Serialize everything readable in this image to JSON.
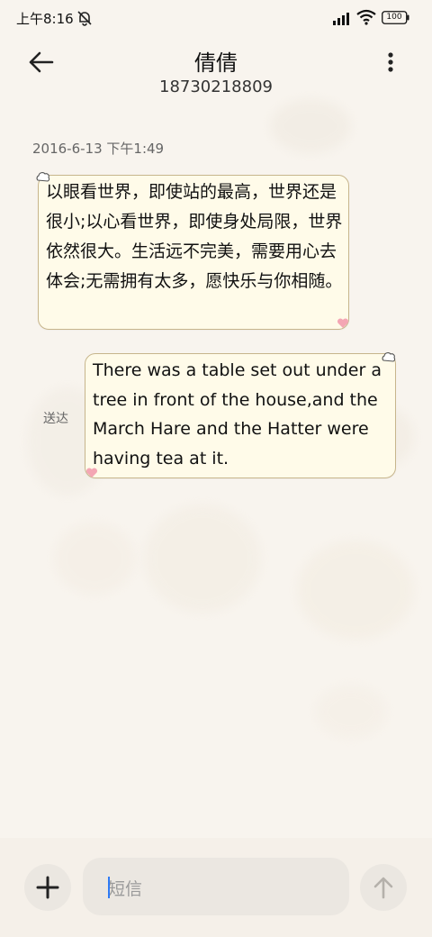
{
  "status_bar": {
    "time": "上午8:16",
    "battery": "100"
  },
  "header": {
    "title": "倩倩",
    "subtitle": "18730218809"
  },
  "conversation": {
    "timestamp": "2016-6-13 下午1:49",
    "messages": [
      {
        "direction": "incoming",
        "text": "以眼看世界，即使站的最高，世界还是很小;以心看世界，即使身处局限，世界依然很大。生活远不完美，需要用心去体会;无需拥有太多，愿快乐与你相随。"
      },
      {
        "direction": "outgoing",
        "text": "There was a table set out under a tree in front of the house,and the March Hare and the Hatter were having tea at it.",
        "status": "送达"
      }
    ]
  },
  "composer": {
    "placeholder": "短信",
    "add_icon": "plus-icon",
    "send_icon": "arrow-up-icon"
  },
  "colors": {
    "background": "#f8f4ee",
    "bubble_fill": "#fffbe9",
    "bubble_border": "#c7b58c",
    "cursor": "#2f7bf5",
    "heart": "#f4a6b4"
  }
}
